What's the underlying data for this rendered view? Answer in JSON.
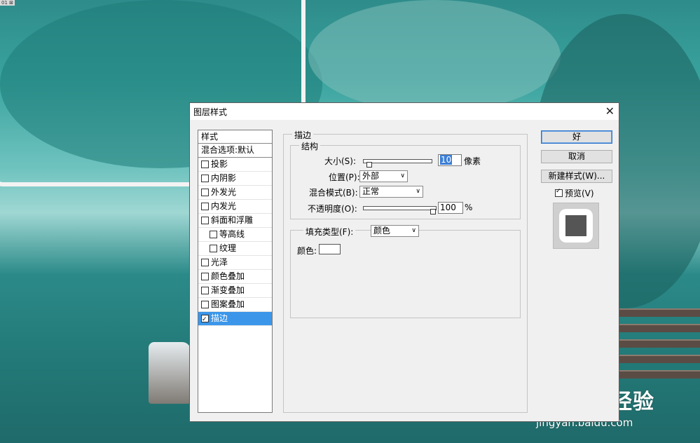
{
  "window": {
    "title": "图层样式",
    "close": "✕"
  },
  "sidebar": {
    "header": "样式",
    "blend": "混合选项:默认",
    "items": [
      {
        "label": "投影",
        "checked": false
      },
      {
        "label": "内阴影",
        "checked": false
      },
      {
        "label": "外发光",
        "checked": false
      },
      {
        "label": "内发光",
        "checked": false
      },
      {
        "label": "斜面和浮雕",
        "checked": false
      },
      {
        "label": "等高线",
        "checked": false
      },
      {
        "label": "纹理",
        "checked": false
      },
      {
        "label": "光泽",
        "checked": false
      },
      {
        "label": "颜色叠加",
        "checked": false
      },
      {
        "label": "渐变叠加",
        "checked": false
      },
      {
        "label": "图案叠加",
        "checked": false
      },
      {
        "label": "描边",
        "checked": true
      }
    ]
  },
  "stroke": {
    "title": "描边",
    "structure": {
      "title": "结构",
      "size_label": "大小(S):",
      "size_value": "10",
      "size_unit": "像素",
      "position_label": "位置(P):",
      "position_value": "外部",
      "blend_label": "混合模式(B):",
      "blend_value": "正常",
      "opacity_label": "不透明度(O):",
      "opacity_value": "100",
      "opacity_unit": "%"
    },
    "fill": {
      "type_label": "填充类型(F):",
      "type_value": "颜色",
      "color_label": "颜色:",
      "color": "#ffffff"
    }
  },
  "buttons": {
    "ok": "好",
    "cancel": "取消",
    "new_style": "新建样式(W)..."
  },
  "preview": {
    "label": "预览(V)",
    "checked": true
  },
  "background": {
    "corner_label": "01 ⊠",
    "watermark_main": "Bai du 经验",
    "watermark_sub": "jingyan.baidu.com"
  }
}
